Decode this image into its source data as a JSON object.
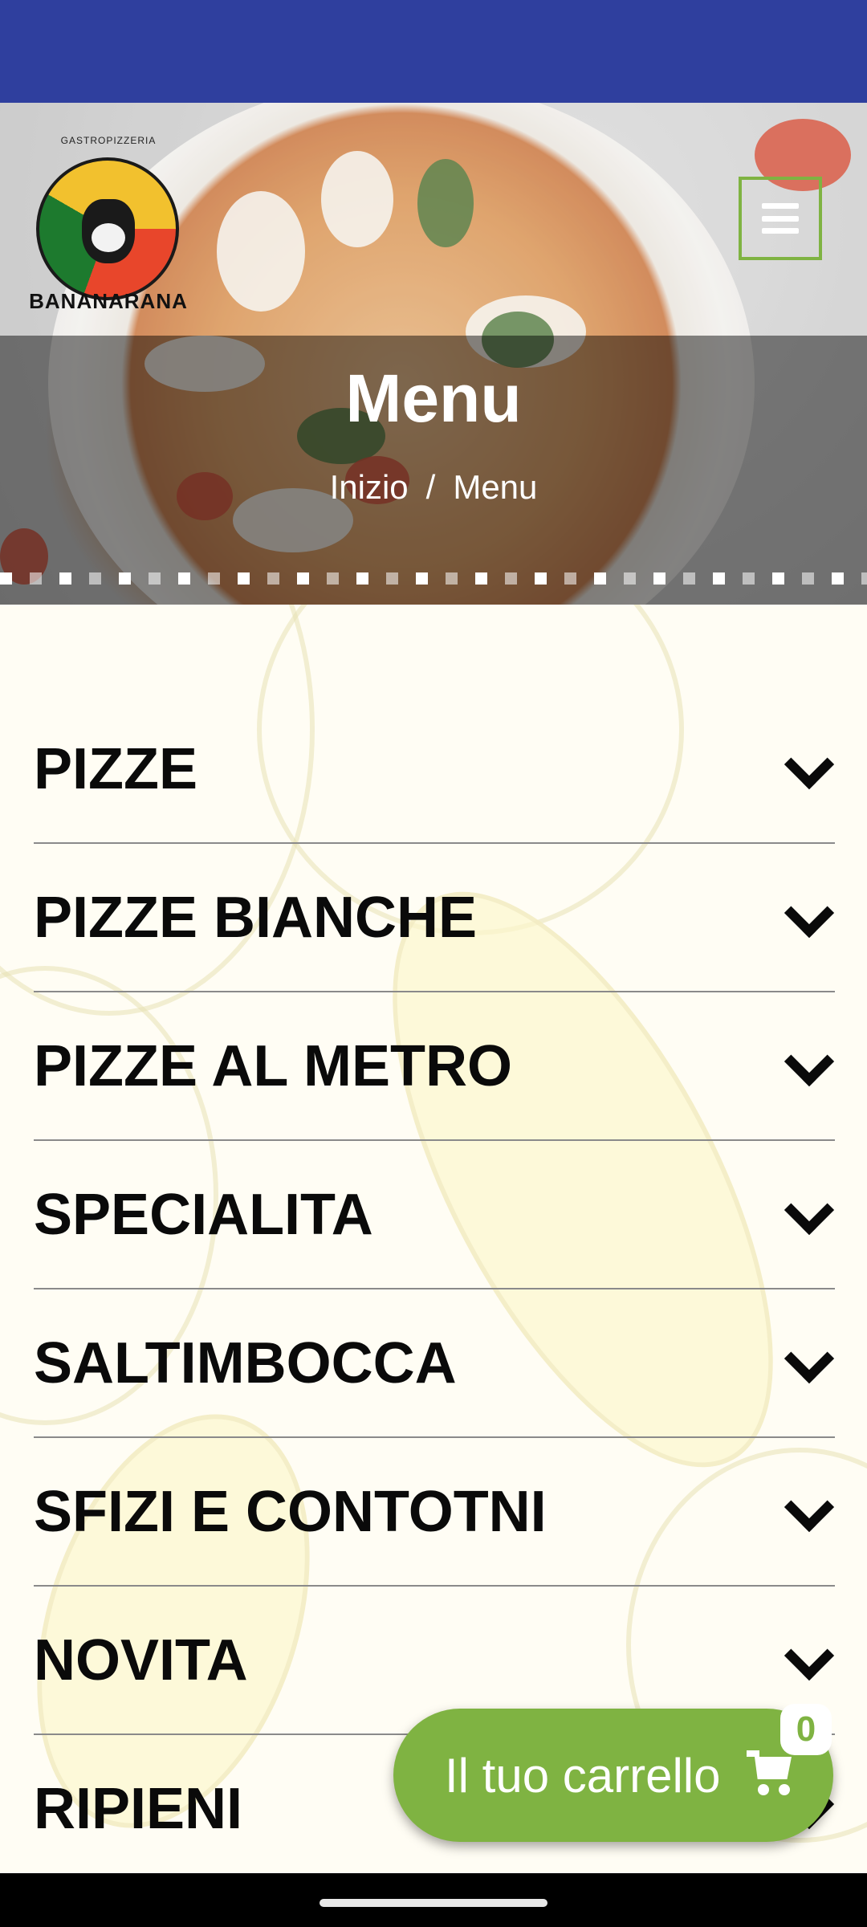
{
  "brand": {
    "tagline": "GASTROPIZZERIA",
    "name": "BANANARANA"
  },
  "header": {
    "page_title": "Menu",
    "breadcrumb": {
      "home": "Inizio",
      "separator": "/",
      "current": "Menu"
    }
  },
  "menu": {
    "categories": [
      {
        "label": "PIZZE"
      },
      {
        "label": "PIZZE BIANCHE"
      },
      {
        "label": "PIZZE AL METRO"
      },
      {
        "label": "SPECIALITA"
      },
      {
        "label": "SALTIMBOCCA"
      },
      {
        "label": "SFIZI E CONTOTNI"
      },
      {
        "label": "NOVITA"
      },
      {
        "label": "RIPIENI"
      }
    ]
  },
  "cart": {
    "label": "Il tuo carrello",
    "count": "0"
  },
  "colors": {
    "status_bar": "#2f3f9e",
    "accent_green": "#7fb342",
    "text": "#0a0a0a"
  },
  "icons": {
    "menu": "hamburger-menu-icon",
    "expand": "chevron-down-icon",
    "cart": "shopping-cart-icon"
  }
}
